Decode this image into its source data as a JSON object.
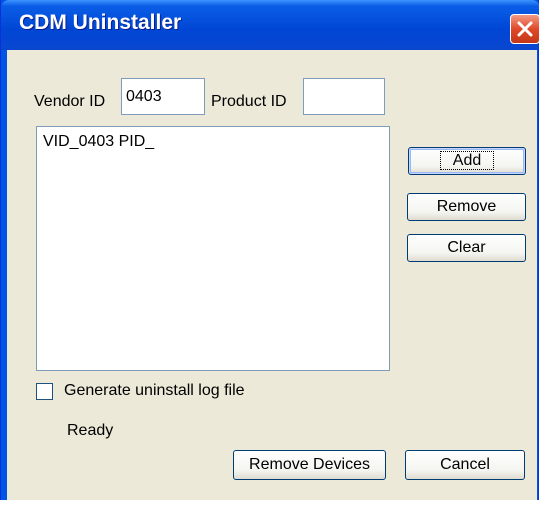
{
  "window": {
    "title": "CDM Uninstaller"
  },
  "form": {
    "vendor_label": "Vendor ID",
    "vendor_value": "0403",
    "product_label": "Product ID",
    "product_value": ""
  },
  "list": {
    "items": [
      "VID_0403 PID_"
    ]
  },
  "buttons": {
    "add": "Add",
    "remove": "Remove",
    "clear": "Clear",
    "remove_devices": "Remove Devices",
    "cancel": "Cancel"
  },
  "options": {
    "log_label": "Generate uninstall log file",
    "log_checked": false
  },
  "status": {
    "text": "Ready"
  },
  "icons": {
    "close": "close-icon"
  },
  "colors": {
    "titlebar": "#0a5de6",
    "client": "#ece9d8",
    "close": "#e0492a"
  }
}
